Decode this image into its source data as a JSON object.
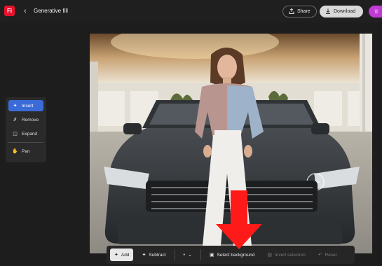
{
  "header": {
    "app_logo": "Fi",
    "back_icon": "chevron-left-icon",
    "title": "Generative fill",
    "share_label": "Share",
    "download_label": "Download"
  },
  "tools": {
    "items": [
      {
        "label": "Insert",
        "icon": "insert-brush-icon",
        "active": true
      },
      {
        "label": "Remove",
        "icon": "remove-brush-icon",
        "active": false
      },
      {
        "label": "Expand",
        "icon": "expand-icon",
        "active": false
      }
    ],
    "pan_label": "Pan"
  },
  "bottom_bar": {
    "add_label": "Add",
    "subtract_label": "Subtract",
    "select_background_label": "Select background",
    "invert_selection_label": "Invert selection",
    "reset_label": "Reset"
  },
  "colors": {
    "accent": "#3a6bd9",
    "brand": "#e8112d",
    "arrow": "#ff1a1a"
  }
}
